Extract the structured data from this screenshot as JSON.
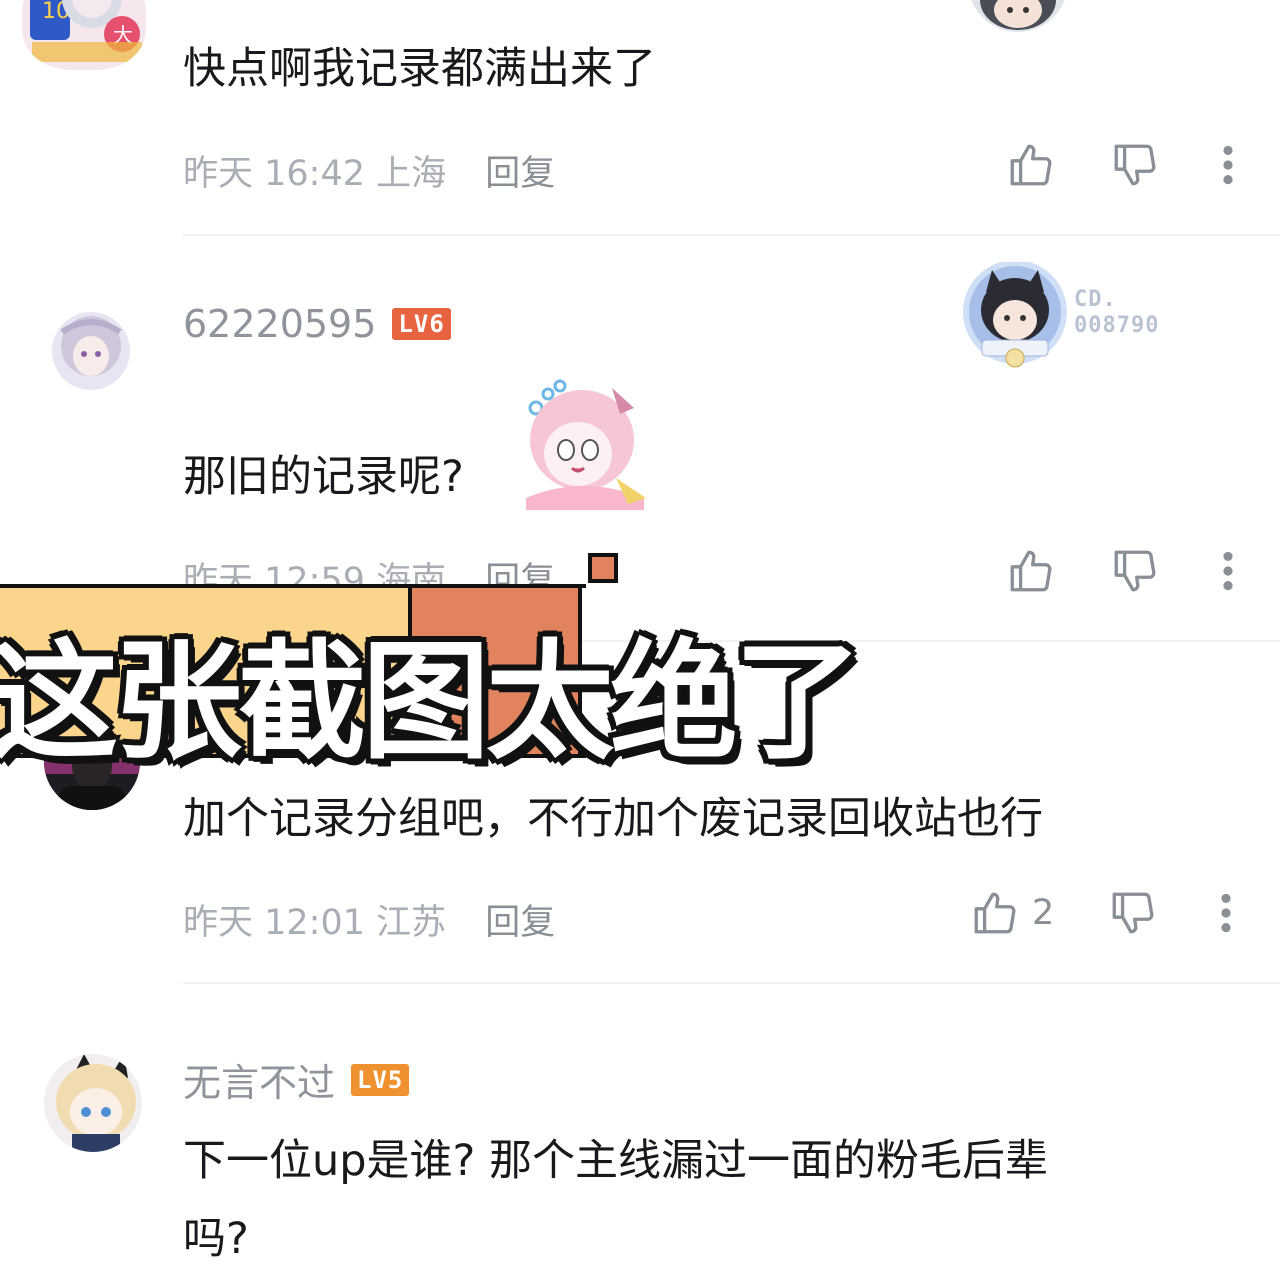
{
  "comments": [
    {
      "text": "快点啊我记录都满出来了",
      "date": "昨天 16:42 上海",
      "reply": "回复",
      "like_count": ""
    },
    {
      "username": "62220595",
      "level": "LV6",
      "text": "那旧的记录呢?",
      "date": "昨天 12:59 海南",
      "reply": "回复",
      "badge_line1": "CD.",
      "badge_line2": "008790",
      "like_count": ""
    },
    {
      "text": "加个记录分组吧，不行加个废记录回收站也行",
      "date": "昨天 12:01 江苏",
      "reply": "回复",
      "like_count": "2"
    },
    {
      "username": "无言不过",
      "level": "LV5",
      "text_line1": "下一位up是谁? 那个主线漏过一面的粉毛后辈",
      "text_line2": "吗?"
    }
  ],
  "overlay_caption": "这张截图太绝了",
  "colors": {
    "banner_yellow": "#fcd58d",
    "banner_orange": "#e1845e",
    "level6": "#e8633f",
    "level5": "#f0912f"
  },
  "icons": [
    "thumbs-up-icon",
    "thumbs-down-icon",
    "more-vertical-icon"
  ]
}
